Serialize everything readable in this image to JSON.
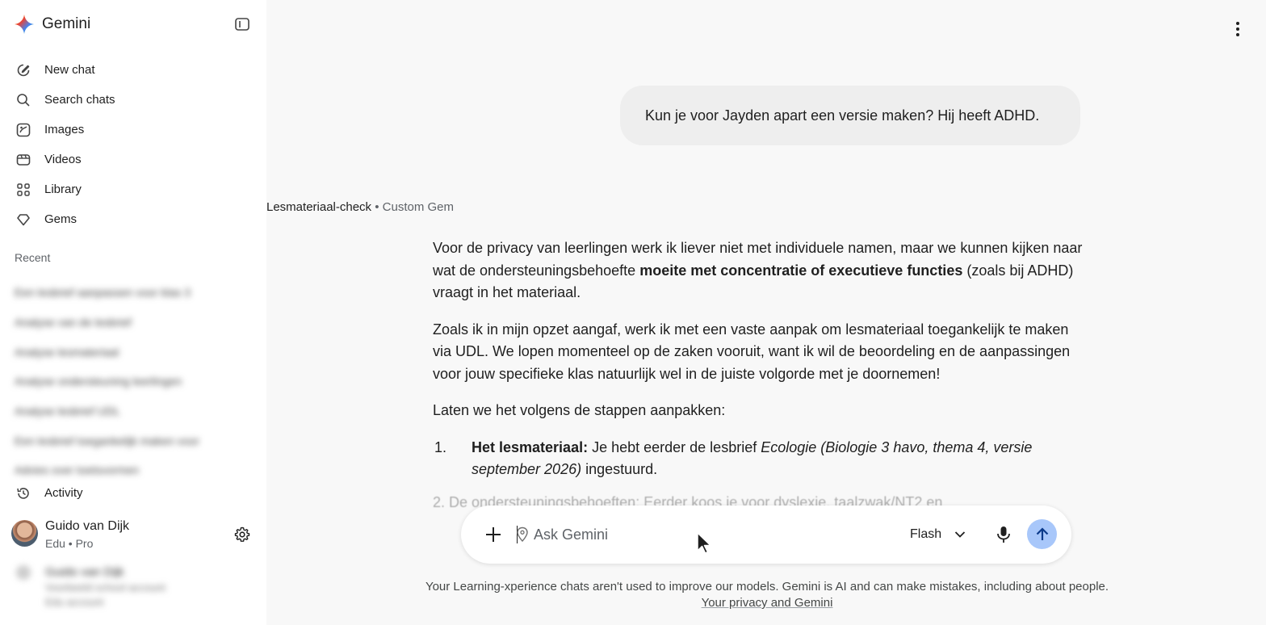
{
  "app": {
    "name": "Gemini"
  },
  "sidebar": {
    "items": [
      {
        "label": "New chat",
        "icon": "pencil-icon"
      },
      {
        "label": "Search chats",
        "icon": "search-icon"
      },
      {
        "label": "Images",
        "icon": "image-icon"
      },
      {
        "label": "Videos",
        "icon": "video-icon"
      },
      {
        "label": "Library",
        "icon": "grid-icon"
      },
      {
        "label": "Gems",
        "icon": "gem-icon"
      }
    ],
    "recent_heading": "Recent",
    "recent": [
      "Een lesbrief aanpassen voor klas 3",
      "Analyse van de lesbrief",
      "Analyse lesmateriaal",
      "Analyse ondersteuning leerlingen",
      "Analyse lesbrief UDL",
      "Een lesbrief toegankelijk maken voor",
      "Advies over toetsvormen"
    ],
    "activity_label": "Activity",
    "profile": {
      "name": "Guido van Dijk",
      "subtitle": "Edu • Pro"
    },
    "blurred_bottom": {
      "line1": "Guido van Dijk",
      "line2": "Voorbeeld school account",
      "line3": "Edu account"
    }
  },
  "chat": {
    "user_message": "Kun je voor Jayden apart een versie maken? Hij heeft ADHD.",
    "gem": {
      "name": "Lesmateriaal-check",
      "separator": "•",
      "type": "Custom Gem"
    },
    "response": {
      "p1_before": "Voor de privacy van leerlingen werk ik liever niet met individuele namen, maar we kunnen kijken naar wat de ondersteuningsbehoefte ",
      "p1_bold": "moeite met concentratie of executieve functies",
      "p1_after": " (zoals bij ADHD) vraagt in het materiaal.",
      "p2": "Zoals ik in mijn opzet aangaf, werk ik met een vaste aanpak om lesmateriaal toegankelijk te maken via UDL. We lopen momenteel op de zaken vooruit, want ik wil de beoordeling en de aanpassingen voor jouw specifieke klas natuurlijk wel in de juiste volgorde met je doornemen!",
      "p3": "Laten we het volgens de stappen aanpakken:",
      "list": [
        {
          "num": "1.",
          "bold": "Het lesmateriaal:",
          "text": " Je hebt eerder de lesbrief ",
          "italic": "Ecologie (Biologie 3 havo, thema 4, versie september 2026)",
          "after": " ingestuurd."
        }
      ],
      "faded_line": "2.   De ondersteuningsbehoeften: Eerder koos je voor dyslexie, taalzwak/NT2 en"
    }
  },
  "composer": {
    "placeholder": "Ask Gemini",
    "model": "Flash"
  },
  "disclaimer": {
    "text": "Your Learning-xperience chats aren't used to improve our models. Gemini is AI and can make mistakes, including about people.",
    "link": "Your privacy and Gemini"
  },
  "colors": {
    "send_button": "#a8c7fa",
    "sidebar_bg": "#ffffff",
    "main_bg": "#f8f8f8",
    "bubble_bg": "#eeeeee"
  }
}
